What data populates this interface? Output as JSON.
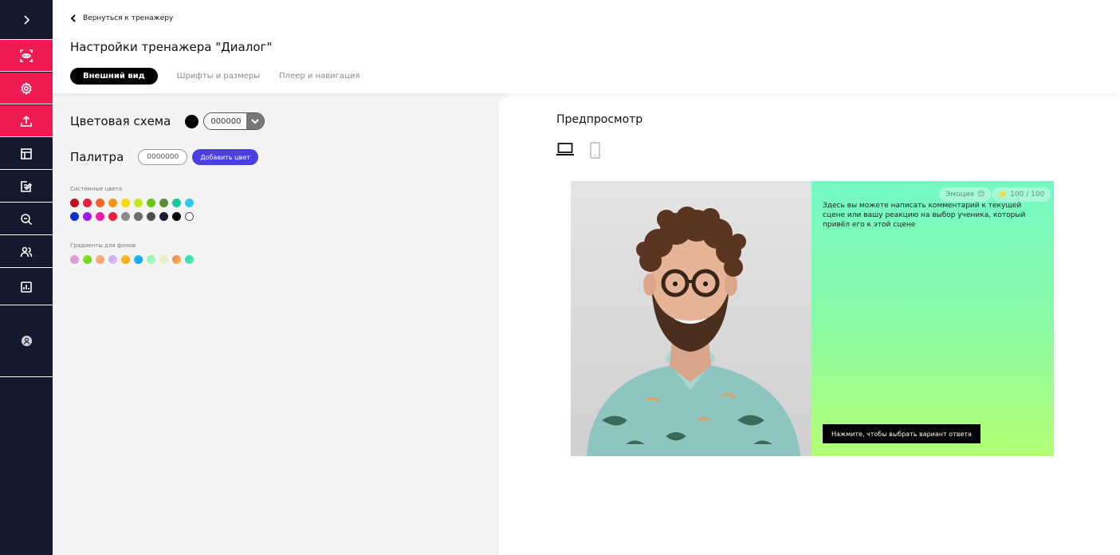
{
  "sidebar": {
    "items": [
      {
        "icon": "chevron-right-icon"
      },
      {
        "icon": "eye-scan-icon"
      },
      {
        "icon": "gear-icon"
      },
      {
        "icon": "upload-icon"
      },
      {
        "icon": "layout-icon"
      },
      {
        "icon": "edit-list-icon"
      },
      {
        "icon": "chat-search-icon"
      },
      {
        "icon": "users-icon"
      },
      {
        "icon": "stats-icon"
      },
      {
        "icon": "user-avatar-icon"
      }
    ]
  },
  "header": {
    "back_label": "Вернуться к тренажеру",
    "title": "Настройки тренажера \"Диалог\"",
    "tabs": [
      {
        "label": "Внешний вид",
        "active": true
      },
      {
        "label": "Шрифты и размеры",
        "active": false
      },
      {
        "label": "Плеер и навигация",
        "active": false
      }
    ]
  },
  "appearance": {
    "color_scheme_label": "Цветовая схема",
    "color_scheme_value": "000000",
    "palette_label": "Палитра",
    "palette_value": "0000000",
    "add_color_label": "Добавить цвет",
    "system_colors_label": "Системные цвета",
    "system_colors_row1": [
      "#c0131c",
      "#e8213a",
      "#f26522",
      "#f7941d",
      "#f5d90a",
      "#c7e81b",
      "#6cc41a",
      "#5a8a3a",
      "#14c9a0",
      "#35c9e8"
    ],
    "system_colors_row2": [
      "#1330c8",
      "#9b1ee8",
      "#e81ea8",
      "#e8213a",
      "#8a8a8a",
      "#6e6e6e",
      "#505050",
      "#1a1a30",
      "#000000",
      "#ffffff"
    ],
    "gradients_label": "Градиенты для фонов",
    "gradient_colors": [
      [
        "#e8a0c8",
        "#c7a0e8"
      ],
      [
        "#9ae81e",
        "#5ac81e"
      ],
      [
        "#f7b58a",
        "#f79a6a"
      ],
      [
        "#c8a8f0",
        "#e0c0f8"
      ],
      [
        "#f7c41d",
        "#f7a01d"
      ],
      [
        "#1ec8f0",
        "#1e90f0"
      ],
      [
        "#8af0b0",
        "#b0f8c8"
      ],
      [
        "#f0f0c0",
        "#e0f0d0"
      ],
      [
        "#f07a5a",
        "#f0c05a"
      ],
      [
        "#1ed8c8",
        "#6ae890"
      ]
    ]
  },
  "preview": {
    "title": "Предпросмотр",
    "emotion_label": "Эмоция",
    "emotion_emoji": "😊",
    "score_icon": "⭐",
    "score": "100 / 100",
    "comment": "Здесь вы можете написать комментарий к текущей сцене или вашу реакцию на выбор ученика, который привёл его к этой сцене",
    "choose_label": "Нажмите, чтобы выбрать вариант ответа"
  }
}
